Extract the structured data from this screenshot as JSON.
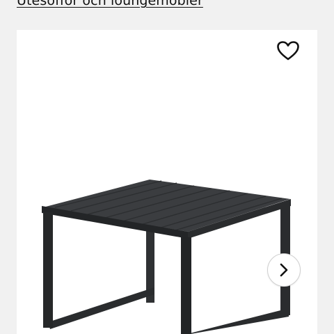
{
  "breadcrumb": {
    "link_label": "Utesoffor och loungemöbler"
  },
  "product": {
    "image_alt": "Black metal outdoor side table"
  },
  "actions": {
    "favorite_icon": "heart-outline-icon",
    "next_icon": "chevron-right-icon"
  },
  "colors": {
    "page_bg": "#f1f1f1",
    "card_bg": "#ffffff",
    "text": "#111111",
    "table_frame": "#2b2d2f",
    "table_top": "#3a3c3e"
  }
}
